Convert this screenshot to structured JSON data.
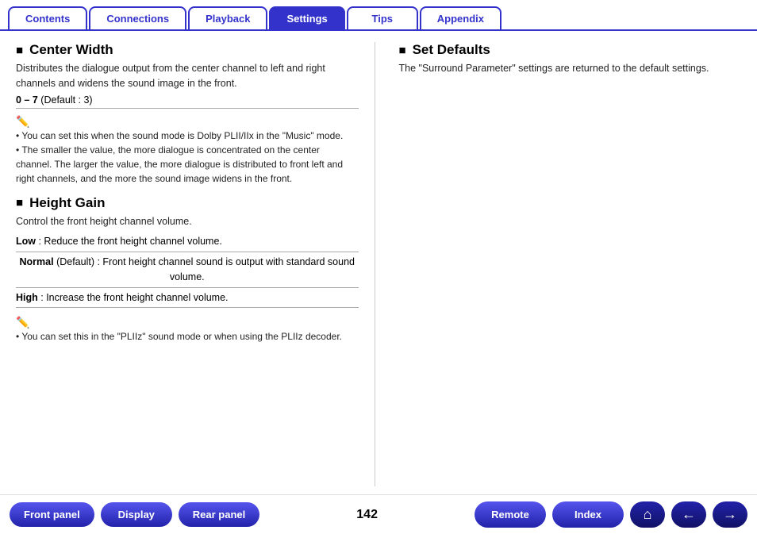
{
  "tabs": [
    {
      "id": "contents",
      "label": "Contents",
      "active": false
    },
    {
      "id": "connections",
      "label": "Connections",
      "active": false
    },
    {
      "id": "playback",
      "label": "Playback",
      "active": false
    },
    {
      "id": "settings",
      "label": "Settings",
      "active": true
    },
    {
      "id": "tips",
      "label": "Tips",
      "active": false
    },
    {
      "id": "appendix",
      "label": "Appendix",
      "active": false
    }
  ],
  "left": {
    "section1": {
      "title": "Center Width",
      "desc": "Distributes the dialogue output from the center channel to left and right channels and widens the sound image in the front.",
      "range_label": "0 – 7",
      "range_detail": "(Default : 3)",
      "notes": [
        "• You can set this when the sound mode is Dolby PLII/IIx in the \"Music\" mode.",
        "• The smaller the value, the more dialogue is concentrated on the center channel. The larger the value, the more dialogue is distributed to front left and right channels, and the more the sound image widens in the front."
      ]
    },
    "section2": {
      "title": "Height Gain",
      "desc": "Control the front height channel volume.",
      "rows": [
        {
          "label": "Low",
          "label_bold": true,
          "text": ": Reduce the front height channel volume."
        },
        {
          "label": "Normal",
          "label_bold": true,
          "extra": "(Default)",
          "text": ": Front height channel sound is output with standard sound volume."
        },
        {
          "label": "High",
          "label_bold": true,
          "text": ": Increase the front height channel volume."
        }
      ],
      "notes": [
        "• You can set this in the \"PLIIz\" sound mode or when using the PLIIz decoder."
      ]
    }
  },
  "right": {
    "section": {
      "title": "Set Defaults",
      "desc": "The \"Surround Parameter\" settings are returned to the default settings."
    }
  },
  "bottom": {
    "page_number": "142",
    "buttons_left": [
      {
        "id": "front-panel",
        "label": "Front panel"
      },
      {
        "id": "display",
        "label": "Display"
      },
      {
        "id": "rear-panel",
        "label": "Rear panel"
      }
    ],
    "buttons_right": [
      {
        "id": "remote",
        "label": "Remote"
      },
      {
        "id": "index",
        "label": "Index"
      }
    ],
    "icons": [
      {
        "id": "home",
        "symbol": "⌂"
      },
      {
        "id": "back",
        "symbol": "←"
      },
      {
        "id": "forward",
        "symbol": "→"
      }
    ]
  }
}
